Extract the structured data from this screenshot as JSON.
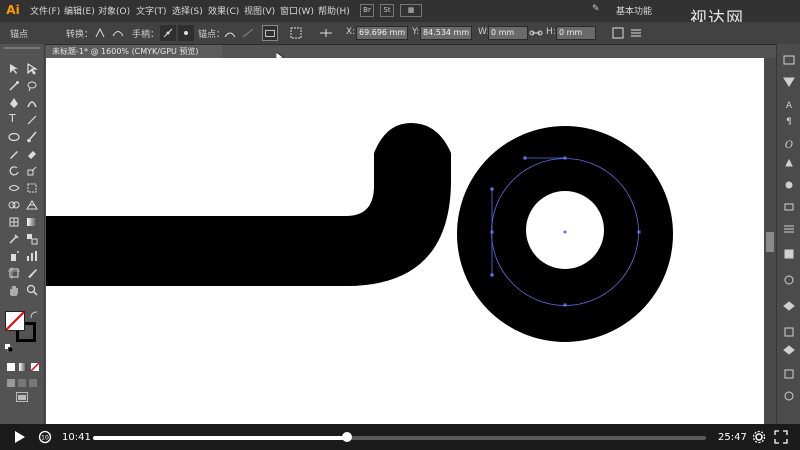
{
  "app": {
    "logo_text": "Ai",
    "workspace": "基本功能"
  },
  "menu": [
    "文件(F)",
    "编辑(E)",
    "对象(O)",
    "文字(T)",
    "选择(S)",
    "效果(C)",
    "视图(V)",
    "窗口(W)",
    "帮助(H)"
  ],
  "menu_badges": {
    "br": "Br",
    "st": "St"
  },
  "control_bar": {
    "selection": "锚点",
    "convert_label": "转换：",
    "handles_label": "手柄：",
    "anchor_label": "锚点：",
    "x_value": "69.696 mm",
    "y_value": "84.534 mm",
    "w_value": "0 mm",
    "h_value": "0 mm"
  },
  "document_tab": "未标题-1* @ 1600% (CMYK/GPU 预览)",
  "watermark": "视达网",
  "video": {
    "current_time": "10:41",
    "total_time": "25:47",
    "progress": 0.415
  },
  "colors": {
    "menubar": "#323232",
    "panel": "#535353",
    "canvas": "#ffffff",
    "path": "#5a6ee8",
    "artwork": "#000000",
    "logo": "#ff9a00"
  },
  "icons": [
    "selection-tool-icon",
    "direct-selection-tool-icon",
    "magic-wand-icon",
    "lasso-icon",
    "pen-tool-icon",
    "curvature-icon",
    "type-tool-icon",
    "line-tool-icon",
    "ellipse-tool-icon",
    "paintbrush-icon",
    "pencil-icon",
    "eraser-icon",
    "rotate-icon",
    "scale-icon",
    "width-tool-icon",
    "free-transform-icon",
    "shape-builder-icon",
    "perspective-grid-icon",
    "mesh-icon",
    "gradient-icon",
    "eyedropper-icon",
    "blend-icon",
    "symbol-sprayer-icon",
    "column-graph-icon",
    "artboard-icon",
    "slice-icon",
    "hand-icon",
    "zoom-icon",
    "fill-swatch-icon",
    "stroke-swatch-icon",
    "play-icon",
    "replay-icon",
    "settings-icon",
    "fullscreen-icon"
  ]
}
